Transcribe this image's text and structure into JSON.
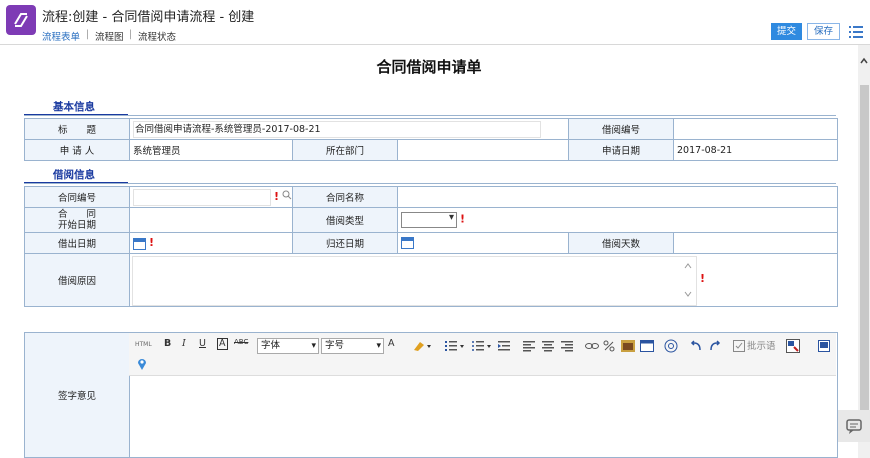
{
  "window": {
    "title": "流程:创建 - 合同借阅申请流程 - 创建"
  },
  "tabs": [
    {
      "label": "流程表单",
      "active": true
    },
    {
      "label": "流程图"
    },
    {
      "label": "流程状态"
    }
  ],
  "toolbar": {
    "submit": "提交",
    "save": "保存"
  },
  "form": {
    "title": "合同借阅申请单",
    "sections": {
      "basic": "基本信息",
      "borrow": "借阅信息"
    },
    "basic": {
      "title_label": "标　　题",
      "title_value": "合同借阅申请流程-系统管理员-2017-08-21",
      "borrow_no_label": "借阅编号",
      "borrow_no_value": "",
      "applicant_label": "申 请 人",
      "applicant_value": "系统管理员",
      "dept_label": "所在部门",
      "dept_value": "",
      "apply_date_label": "申请日期",
      "apply_date_value": "2017-08-21"
    },
    "borrow": {
      "contract_no_label": "合同编号",
      "contract_name_label": "合同名称",
      "start_date_label_1": "合　　同",
      "start_date_label_2": "开始日期",
      "borrow_type_label": "借阅类型",
      "out_date_label": "借出日期",
      "return_date_label": "归还日期",
      "days_label": "借阅天数",
      "reason_label": "借阅原因"
    },
    "signature": {
      "label": "签字意见"
    }
  },
  "editor": {
    "html_label": "HTML",
    "bold": "B",
    "italic": "I",
    "underline": "U",
    "font_color_a": "A",
    "strike": "ABC",
    "font_family": "字体",
    "font_size": "字号",
    "text_color": "A",
    "phrase": "批示语"
  },
  "colors": {
    "accent": "#2f8ae0",
    "label_bg": "#eef4fb",
    "border": "#9ab3cf",
    "section": "#1a3aa0",
    "required": "#dd1111",
    "app_icon": "#7e3bb5"
  }
}
